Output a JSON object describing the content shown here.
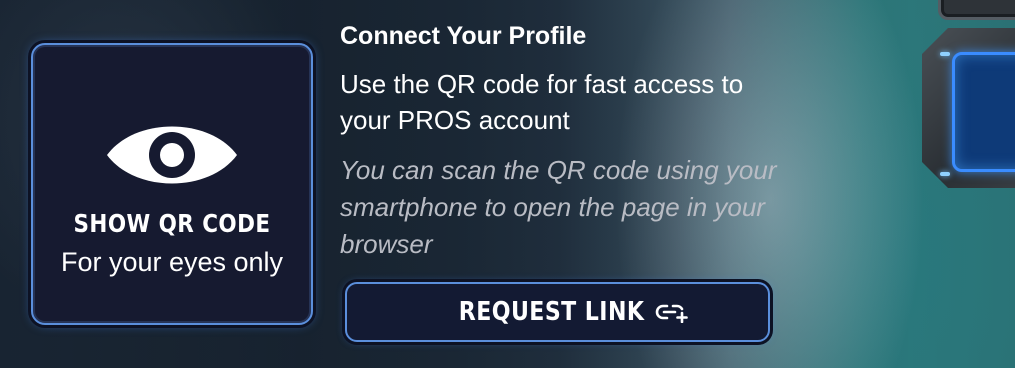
{
  "qr_card": {
    "icon": "eye-icon",
    "title": "SHOW QR CODE",
    "subtitle": "For your eyes only"
  },
  "connect": {
    "heading": "Connect Your Profile",
    "body": "Use the QR code for fast access to your PROS account",
    "hint": "You can scan the QR code using your smartphone to open the page in your browser"
  },
  "request_button": {
    "label": "REQUEST LINK",
    "icon": "link-add-icon"
  },
  "colors": {
    "accent_border": "#5b8fdc",
    "card_bg": "#161a30",
    "hint_text": "#b9bcc4"
  }
}
